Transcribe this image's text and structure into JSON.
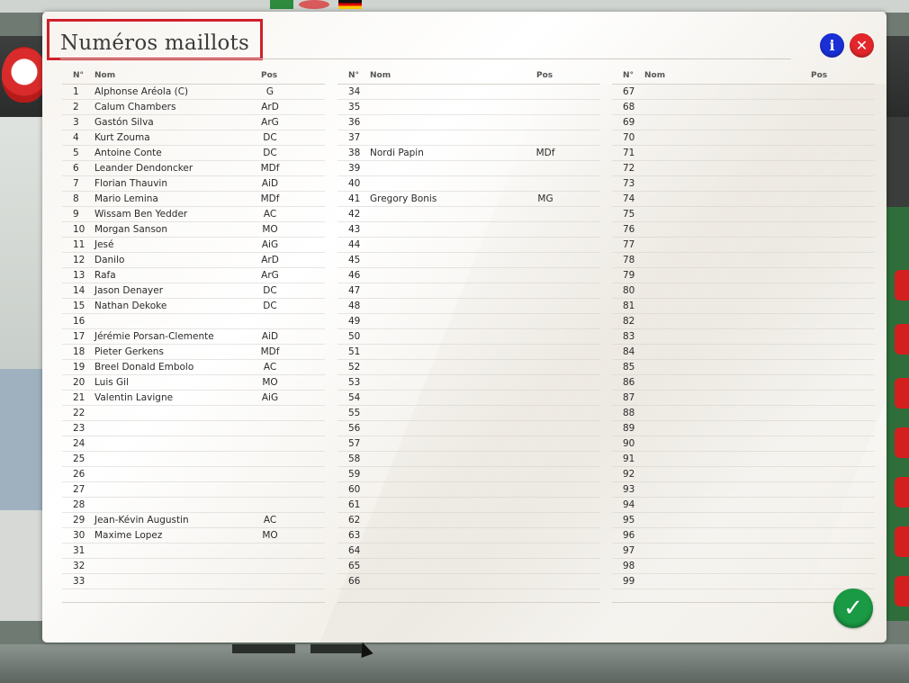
{
  "dialog": {
    "title": "Numéros maillots",
    "info_icon": "info-icon",
    "close_icon": "close-icon",
    "confirm_icon": "checkmark-icon",
    "info_glyph": "i",
    "close_glyph": "✕",
    "confirm_glyph": "✓"
  },
  "columns_header": {
    "num": "N°",
    "nom": "Nom",
    "pos": "Pos"
  },
  "players": [
    {
      "num": "1",
      "name": "Alphonse Aréola (C)",
      "pos": "G"
    },
    {
      "num": "2",
      "name": "Calum Chambers",
      "pos": "ArD"
    },
    {
      "num": "3",
      "name": "Gastón Silva",
      "pos": "ArG"
    },
    {
      "num": "4",
      "name": "Kurt Zouma",
      "pos": "DC"
    },
    {
      "num": "5",
      "name": "Antoine Conte",
      "pos": "DC"
    },
    {
      "num": "6",
      "name": "Leander Dendoncker",
      "pos": "MDf"
    },
    {
      "num": "7",
      "name": "Florian Thauvin",
      "pos": "AiD"
    },
    {
      "num": "8",
      "name": "Mario Lemina",
      "pos": "MDf"
    },
    {
      "num": "9",
      "name": "Wissam Ben Yedder",
      "pos": "AC"
    },
    {
      "num": "10",
      "name": "Morgan Sanson",
      "pos": "MO"
    },
    {
      "num": "11",
      "name": "Jesé",
      "pos": "AiG"
    },
    {
      "num": "12",
      "name": "Danilo",
      "pos": "ArD"
    },
    {
      "num": "13",
      "name": "Rafa",
      "pos": "ArG"
    },
    {
      "num": "14",
      "name": "Jason Denayer",
      "pos": "DC"
    },
    {
      "num": "15",
      "name": "Nathan Dekoke",
      "pos": "DC"
    },
    {
      "num": "16",
      "name": "",
      "pos": ""
    },
    {
      "num": "17",
      "name": "Jérémie Porsan-Clemente",
      "pos": "AiD"
    },
    {
      "num": "18",
      "name": "Pieter Gerkens",
      "pos": "MDf"
    },
    {
      "num": "19",
      "name": "Breel Donald Embolo",
      "pos": "AC"
    },
    {
      "num": "20",
      "name": "Luis Gil",
      "pos": "MO"
    },
    {
      "num": "21",
      "name": "Valentin Lavigne",
      "pos": "AiG"
    },
    {
      "num": "22",
      "name": "",
      "pos": ""
    },
    {
      "num": "23",
      "name": "",
      "pos": ""
    },
    {
      "num": "24",
      "name": "",
      "pos": ""
    },
    {
      "num": "25",
      "name": "",
      "pos": ""
    },
    {
      "num": "26",
      "name": "",
      "pos": ""
    },
    {
      "num": "27",
      "name": "",
      "pos": ""
    },
    {
      "num": "28",
      "name": "",
      "pos": ""
    },
    {
      "num": "29",
      "name": "Jean-Kévin Augustin",
      "pos": "AC"
    },
    {
      "num": "30",
      "name": "Maxime Lopez",
      "pos": "MO"
    },
    {
      "num": "31",
      "name": "",
      "pos": ""
    },
    {
      "num": "32",
      "name": "",
      "pos": ""
    },
    {
      "num": "33",
      "name": "",
      "pos": ""
    },
    {
      "num": "34",
      "name": "",
      "pos": ""
    },
    {
      "num": "35",
      "name": "",
      "pos": ""
    },
    {
      "num": "36",
      "name": "",
      "pos": ""
    },
    {
      "num": "37",
      "name": "",
      "pos": ""
    },
    {
      "num": "38",
      "name": "Nordi Papin",
      "pos": "MDf"
    },
    {
      "num": "39",
      "name": "",
      "pos": ""
    },
    {
      "num": "40",
      "name": "",
      "pos": ""
    },
    {
      "num": "41",
      "name": "Gregory Bonis",
      "pos": "MG"
    },
    {
      "num": "42",
      "name": "",
      "pos": ""
    },
    {
      "num": "43",
      "name": "",
      "pos": ""
    },
    {
      "num": "44",
      "name": "",
      "pos": ""
    },
    {
      "num": "45",
      "name": "",
      "pos": ""
    },
    {
      "num": "46",
      "name": "",
      "pos": ""
    },
    {
      "num": "47",
      "name": "",
      "pos": ""
    },
    {
      "num": "48",
      "name": "",
      "pos": ""
    },
    {
      "num": "49",
      "name": "",
      "pos": ""
    },
    {
      "num": "50",
      "name": "",
      "pos": ""
    },
    {
      "num": "51",
      "name": "",
      "pos": ""
    },
    {
      "num": "52",
      "name": "",
      "pos": ""
    },
    {
      "num": "53",
      "name": "",
      "pos": ""
    },
    {
      "num": "54",
      "name": "",
      "pos": ""
    },
    {
      "num": "55",
      "name": "",
      "pos": ""
    },
    {
      "num": "56",
      "name": "",
      "pos": ""
    },
    {
      "num": "57",
      "name": "",
      "pos": ""
    },
    {
      "num": "58",
      "name": "",
      "pos": ""
    },
    {
      "num": "59",
      "name": "",
      "pos": ""
    },
    {
      "num": "60",
      "name": "",
      "pos": ""
    },
    {
      "num": "61",
      "name": "",
      "pos": ""
    },
    {
      "num": "62",
      "name": "",
      "pos": ""
    },
    {
      "num": "63",
      "name": "",
      "pos": ""
    },
    {
      "num": "64",
      "name": "",
      "pos": ""
    },
    {
      "num": "65",
      "name": "",
      "pos": ""
    },
    {
      "num": "66",
      "name": "",
      "pos": ""
    },
    {
      "num": "67",
      "name": "",
      "pos": ""
    },
    {
      "num": "68",
      "name": "",
      "pos": ""
    },
    {
      "num": "69",
      "name": "",
      "pos": ""
    },
    {
      "num": "70",
      "name": "",
      "pos": ""
    },
    {
      "num": "71",
      "name": "",
      "pos": ""
    },
    {
      "num": "72",
      "name": "",
      "pos": ""
    },
    {
      "num": "73",
      "name": "",
      "pos": ""
    },
    {
      "num": "74",
      "name": "",
      "pos": ""
    },
    {
      "num": "75",
      "name": "",
      "pos": ""
    },
    {
      "num": "76",
      "name": "",
      "pos": ""
    },
    {
      "num": "77",
      "name": "",
      "pos": ""
    },
    {
      "num": "78",
      "name": "",
      "pos": ""
    },
    {
      "num": "79",
      "name": "",
      "pos": ""
    },
    {
      "num": "80",
      "name": "",
      "pos": ""
    },
    {
      "num": "81",
      "name": "",
      "pos": ""
    },
    {
      "num": "82",
      "name": "",
      "pos": ""
    },
    {
      "num": "83",
      "name": "",
      "pos": ""
    },
    {
      "num": "84",
      "name": "",
      "pos": ""
    },
    {
      "num": "85",
      "name": "",
      "pos": ""
    },
    {
      "num": "86",
      "name": "",
      "pos": ""
    },
    {
      "num": "87",
      "name": "",
      "pos": ""
    },
    {
      "num": "88",
      "name": "",
      "pos": ""
    },
    {
      "num": "89",
      "name": "",
      "pos": ""
    },
    {
      "num": "90",
      "name": "",
      "pos": ""
    },
    {
      "num": "91",
      "name": "",
      "pos": ""
    },
    {
      "num": "92",
      "name": "",
      "pos": ""
    },
    {
      "num": "93",
      "name": "",
      "pos": ""
    },
    {
      "num": "94",
      "name": "",
      "pos": ""
    },
    {
      "num": "95",
      "name": "",
      "pos": ""
    },
    {
      "num": "96",
      "name": "",
      "pos": ""
    },
    {
      "num": "97",
      "name": "",
      "pos": ""
    },
    {
      "num": "98",
      "name": "",
      "pos": ""
    },
    {
      "num": "99",
      "name": "",
      "pos": ""
    }
  ],
  "colors": {
    "info_button": "#1a2fd6",
    "close_button": "#e3262b",
    "confirm_button": "#1a9a44",
    "title_highlight": "#d0202b"
  }
}
